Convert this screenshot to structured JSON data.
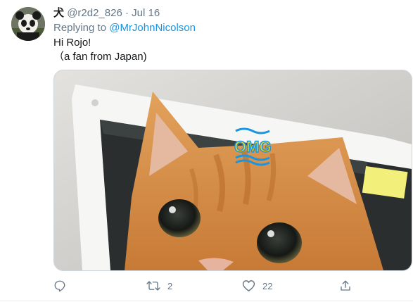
{
  "tweet": {
    "display_name": "犬",
    "handle": "@r2d2_826",
    "separator": "·",
    "date": "Jul 16",
    "replying_prefix": "Replying to",
    "replying_to": "@MrJohnNicolson",
    "text_lines": [
      "Hi Rojo!",
      "（a fan from Japan)"
    ],
    "media": {
      "sticker_text": "OMG",
      "sticker_color": "#f5d90a",
      "sticker_outline": "#1b95e0"
    },
    "actions": {
      "reply": {
        "icon": "reply-icon",
        "count": ""
      },
      "retweet": {
        "icon": "retweet-icon",
        "count": "2"
      },
      "like": {
        "icon": "heart-icon",
        "count": "22"
      },
      "share": {
        "icon": "share-icon"
      }
    }
  }
}
